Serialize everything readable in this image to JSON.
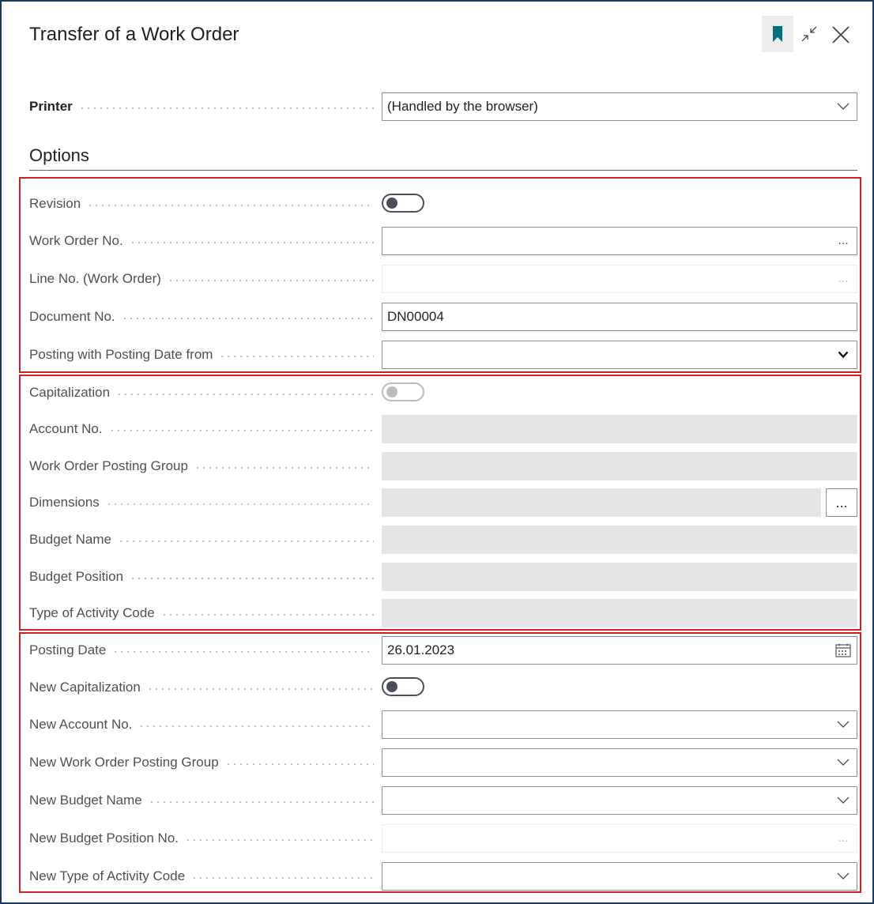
{
  "dialog": {
    "title": "Transfer of a Work Order",
    "icons": {
      "bookmark": "bookmark-icon",
      "collapse": "collapse-icon",
      "close": "close-icon"
    }
  },
  "printer": {
    "label": "Printer",
    "value": "(Handled by the browser)"
  },
  "options": {
    "title": "Options"
  },
  "group1": {
    "revision": {
      "label": "Revision",
      "on": false
    },
    "work_order_no": {
      "label": "Work Order No.",
      "value": "",
      "suffix": "..."
    },
    "line_no": {
      "label": "Line No. (Work Order)",
      "value": "",
      "suffix": "..."
    },
    "document_no": {
      "label": "Document No.",
      "value": "DN00004"
    },
    "posting_date_from": {
      "label": "Posting with Posting Date from",
      "value": ""
    }
  },
  "group2": {
    "capitalization": {
      "label": "Capitalization",
      "on": false
    },
    "account_no": {
      "label": "Account No.",
      "value": ""
    },
    "wo_posting_group": {
      "label": "Work Order Posting Group",
      "value": ""
    },
    "dimensions": {
      "label": "Dimensions",
      "value": "",
      "button": "..."
    },
    "budget_name": {
      "label": "Budget Name",
      "value": ""
    },
    "budget_position": {
      "label": "Budget Position",
      "value": ""
    },
    "activity_code": {
      "label": "Type of Activity Code",
      "value": ""
    }
  },
  "group3": {
    "posting_date": {
      "label": "Posting Date",
      "value": "26.01.2023"
    },
    "new_capitalization": {
      "label": "New Capitalization",
      "on": false
    },
    "new_account_no": {
      "label": "New Account No.",
      "value": ""
    },
    "new_wo_posting_group": {
      "label": "New Work Order Posting Group",
      "value": ""
    },
    "new_budget_name": {
      "label": "New Budget Name",
      "value": ""
    },
    "new_budget_position_no": {
      "label": "New Budget Position No.",
      "value": "",
      "suffix": "..."
    },
    "new_activity_code": {
      "label": "New Type of Activity Code",
      "value": ""
    }
  },
  "colors": {
    "accent": "#00707a",
    "highlight_border": "#cc2222",
    "disabled_fill": "#e4e5e7"
  }
}
